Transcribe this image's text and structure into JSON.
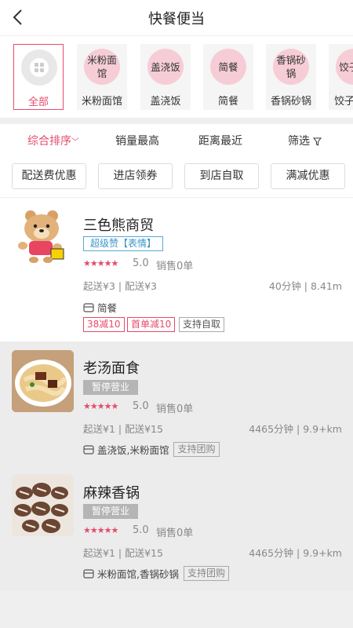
{
  "header": {
    "title": "快餐便当"
  },
  "categories": [
    {
      "circle_text": "",
      "label": "全部",
      "active": true
    },
    {
      "circle_text": "米粉面馆",
      "label": "米粉面馆"
    },
    {
      "circle_text": "盖浇饭",
      "label": "盖浇饭"
    },
    {
      "circle_text": "简餐",
      "label": "简餐"
    },
    {
      "circle_text": "香锅砂锅",
      "label": "香锅砂锅"
    },
    {
      "circle_text": "饺子馆",
      "label": "饺子"
    }
  ],
  "sort": {
    "comprehensive": "综合排序",
    "sales": "销量最高",
    "distance": "距离最近",
    "filter": "筛选"
  },
  "filters": [
    "配送费优惠",
    "进店领券",
    "到店自取",
    "满减优惠"
  ],
  "shops": [
    {
      "name": "三色熊商贸",
      "badge": "超级赞【表情】",
      "stars": "★★★★★",
      "rating": "5.0",
      "sales": "销售0单",
      "fee": "起送¥3 | 配送¥3",
      "distance": "40分钟 | 8.41m",
      "category": "简餐",
      "tags_red": [
        "38减10",
        "首单减10"
      ],
      "tag_gray": "支持自取"
    },
    {
      "name": "老汤面食",
      "badge": "暂停营业",
      "stars": "★★★★★",
      "rating": "5.0",
      "sales": "销售0单",
      "fee": "起送¥1 | 配送¥15",
      "distance": "4465分钟 | 9.9+km",
      "category": "盖浇饭,米粉面馆",
      "tag_gray": "支持团购"
    },
    {
      "name": "麻辣香锅",
      "badge": "暂停营业",
      "stars": "★★★★★",
      "rating": "5.0",
      "sales": "销售0单",
      "fee": "起送¥1 | 配送¥15",
      "distance": "4465分钟 | 9.9+km",
      "category": "米粉面馆,香锅砂锅",
      "tag_gray": "支持团购"
    }
  ],
  "colors": {
    "accent": "#e64b6b",
    "badge_blue": "#3d95c9",
    "closed_bg": "#ececec"
  }
}
